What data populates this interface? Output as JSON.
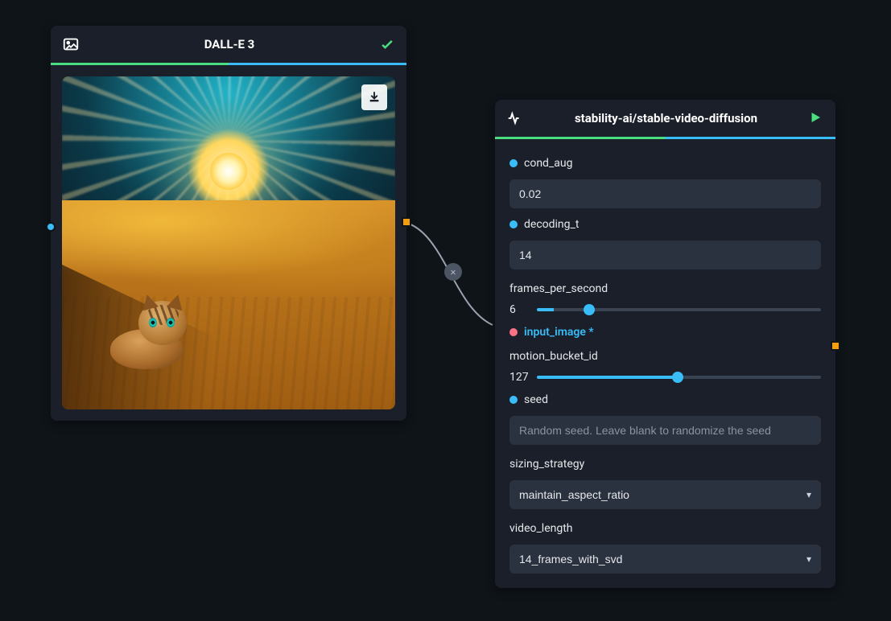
{
  "nodes": {
    "dalle": {
      "title": "DALL-E 3",
      "icon": "image-icon",
      "status": "success"
    },
    "svd": {
      "title": "stability-ai/stable-video-diffusion",
      "icon": "pulse-icon",
      "status": "play",
      "params": {
        "cond_aug": {
          "label": "cond_aug",
          "value": "0.02"
        },
        "decoding_t": {
          "label": "decoding_t",
          "value": "14"
        },
        "frames_per_second": {
          "label": "frames_per_second",
          "value": "6",
          "min": 1,
          "max": 30
        },
        "input_image": {
          "label": "input_image *"
        },
        "motion_bucket_id": {
          "label": "motion_bucket_id",
          "value": "127",
          "min": 1,
          "max": 255
        },
        "seed": {
          "label": "seed",
          "placeholder": "Random seed. Leave blank to randomize the seed",
          "value": ""
        },
        "sizing_strategy": {
          "label": "sizing_strategy",
          "value": "maintain_aspect_ratio"
        },
        "video_length": {
          "label": "video_length",
          "value": "14_frames_with_svd"
        }
      }
    }
  },
  "edge": {
    "delete_label": "×"
  }
}
